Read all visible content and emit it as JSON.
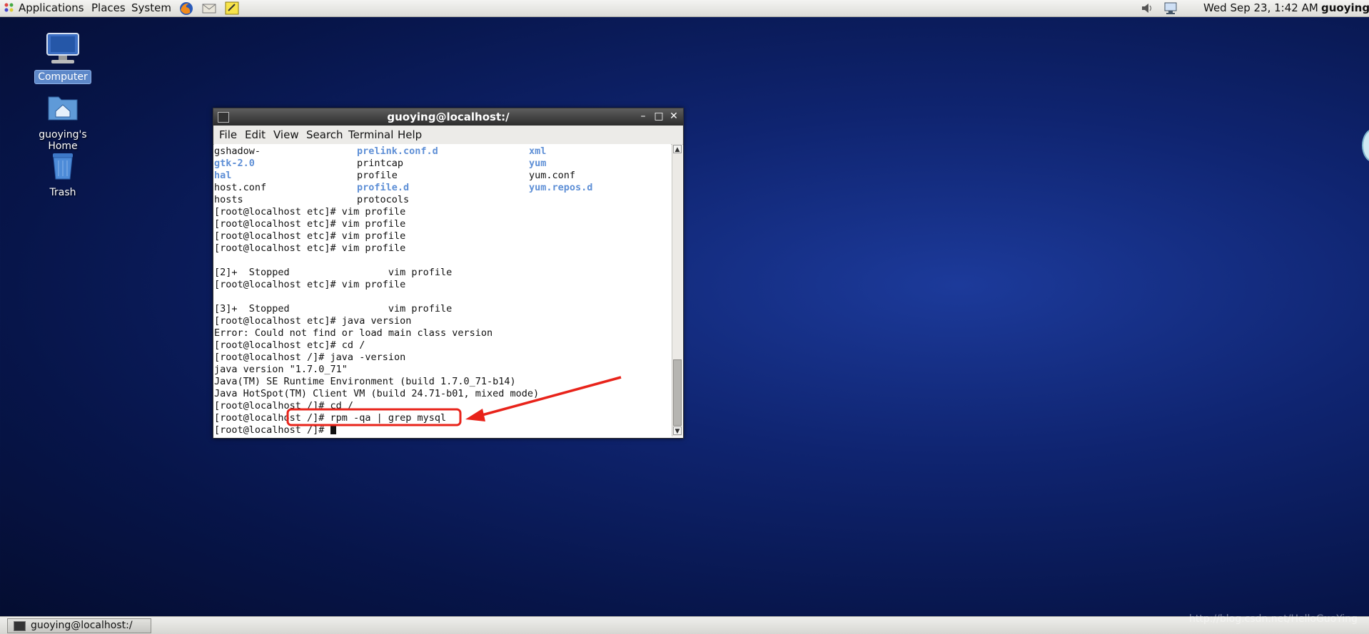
{
  "top_panel": {
    "menus": [
      "Applications",
      "Places",
      "System"
    ],
    "launchers": [
      "firefox-icon",
      "mail-icon",
      "notes-icon"
    ],
    "clock": "Wed Sep 23,  1:42 AM",
    "user": "guoying",
    "tray": [
      "volume-icon",
      "network-icon"
    ]
  },
  "desktop_icons": [
    {
      "label": "Computer",
      "icon": "computer-icon"
    },
    {
      "label": "guoying's Home",
      "icon": "home-folder-icon"
    },
    {
      "label": "Trash",
      "icon": "trash-icon"
    }
  ],
  "terminal": {
    "title": "guoying@localhost:/",
    "menu": [
      "File",
      "Edit",
      "View",
      "Search",
      "Terminal",
      "Help"
    ],
    "listing": [
      [
        {
          "t": "gshadow-",
          "dir": false
        },
        {
          "t": "prelink.conf.d",
          "dir": true
        },
        {
          "t": "xml",
          "dir": true
        }
      ],
      [
        {
          "t": "gtk-2.0",
          "dir": true
        },
        {
          "t": "printcap",
          "dir": false
        },
        {
          "t": "yum",
          "dir": true
        }
      ],
      [
        {
          "t": "hal",
          "dir": true
        },
        {
          "t": "profile",
          "dir": false
        },
        {
          "t": "yum.conf",
          "dir": false
        }
      ],
      [
        {
          "t": "host.conf",
          "dir": false
        },
        {
          "t": "profile.d",
          "dir": true
        },
        {
          "t": "yum.repos.d",
          "dir": true
        }
      ],
      [
        {
          "t": "hosts",
          "dir": false
        },
        {
          "t": "protocols",
          "dir": false
        },
        {
          "t": "",
          "dir": false
        }
      ]
    ],
    "lines": [
      "[root@localhost etc]# vim profile",
      "[root@localhost etc]# vim profile",
      "[root@localhost etc]# vim profile",
      "[root@localhost etc]# vim profile",
      "",
      "[2]+  Stopped                 vim profile",
      "[root@localhost etc]# vim profile",
      "",
      "[3]+  Stopped                 vim profile",
      "[root@localhost etc]# java version",
      "Error: Could not find or load main class version",
      "[root@localhost etc]# cd /",
      "[root@localhost /]# java -version",
      "java version \"1.7.0_71\"",
      "Java(TM) SE Runtime Environment (build 1.7.0_71-b14)",
      "Java HotSpot(TM) Client VM (build 24.71-b01, mixed mode)",
      "[root@localhost /]# cd /",
      "[root@localhost /]# rpm -qa | grep mysql",
      "[root@localhost /]# "
    ]
  },
  "annotation": {
    "color": "#e8231a"
  },
  "taskbar": {
    "item": "guoying@localhost:/"
  },
  "watermark": "http://blog.csdn.net/HelloGuoYing"
}
